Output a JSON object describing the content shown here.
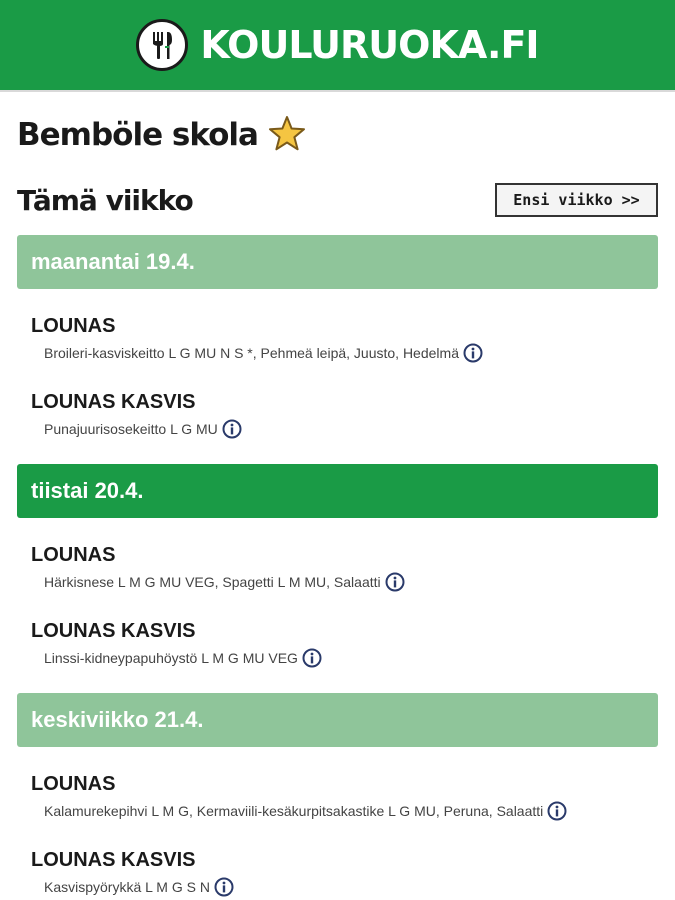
{
  "header": {
    "brand": "KOULURUOKA.FI",
    "logo_icon": "fork-knife-plate-icon",
    "bg_color": "#1a9b46"
  },
  "school": {
    "name": "Bemböle skola",
    "favorite_icon": "star-icon"
  },
  "week": {
    "title": "Tämä viikko",
    "next_button": "Ensi viikko >>"
  },
  "days": [
    {
      "label": "maanantai 19.4.",
      "style": "light",
      "meals": [
        {
          "title": "LOUNAS",
          "desc": "Broileri-kasviskeitto L G MU N S *, Pehmeä leipä, Juusto, Hedelmä"
        },
        {
          "title": "LOUNAS KASVIS",
          "desc": "Punajuurisosekeitto L G MU"
        }
      ]
    },
    {
      "label": "tiistai 20.4.",
      "style": "dark",
      "meals": [
        {
          "title": "LOUNAS",
          "desc": "Härkisnese L M G MU VEG, Spagetti L M MU, Salaatti"
        },
        {
          "title": "LOUNAS KASVIS",
          "desc": "Linssi-kidneypapuhöystö L M G MU VEG"
        }
      ]
    },
    {
      "label": "keskiviikko 21.4.",
      "style": "light",
      "meals": [
        {
          "title": "LOUNAS",
          "desc": "Kalamurekepihvi L M G, Kermaviili-kesäkurpitsakastike L G MU, Peruna, Salaatti"
        },
        {
          "title": "LOUNAS KASVIS",
          "desc": "Kasvispyörykkä L M G S N"
        }
      ]
    }
  ]
}
